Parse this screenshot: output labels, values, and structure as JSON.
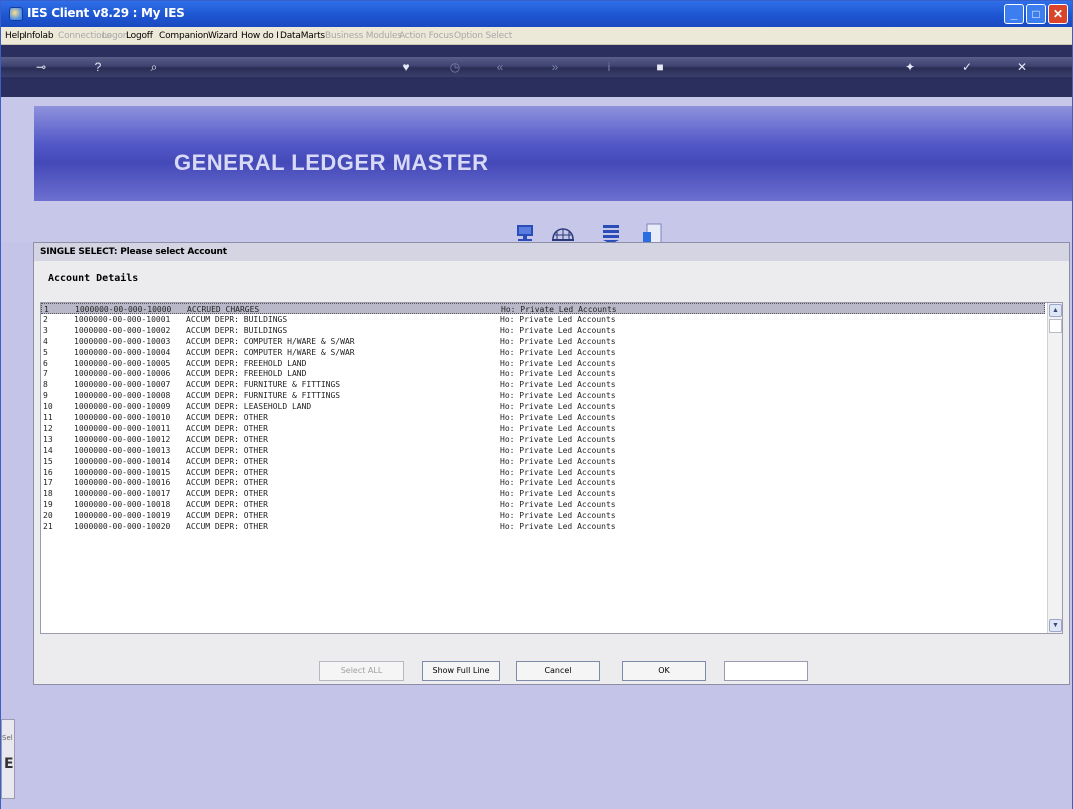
{
  "window": {
    "title": "IES Client v8.29 : My IES",
    "controls": [
      "minimize",
      "maximize",
      "close"
    ]
  },
  "menu": [
    {
      "label": "Help",
      "enabled": true
    },
    {
      "label": "Infolab",
      "enabled": true
    },
    {
      "label": "Connections",
      "enabled": false
    },
    {
      "label": "Logon",
      "enabled": false
    },
    {
      "label": "Logoff",
      "enabled": true
    },
    {
      "label": "Companion",
      "enabled": true
    },
    {
      "label": "Wizard",
      "enabled": true
    },
    {
      "label": "How do I",
      "enabled": true
    },
    {
      "label": "DataMarts",
      "enabled": true
    },
    {
      "label": "Business Modules",
      "enabled": false
    },
    {
      "label": "Action Focus",
      "enabled": false
    },
    {
      "label": "Option Select",
      "enabled": false
    }
  ],
  "toolbar": {
    "icons": [
      "key-icon",
      "help-icon",
      "search-icon",
      "heart-icon",
      "clock-icon",
      "back-icon",
      "forward-icon",
      "info-icon",
      "stop-icon",
      "tools-icon",
      "check-icon",
      "close-icon"
    ]
  },
  "banner": {
    "title": "GENERAL LEDGER MASTER"
  },
  "dialog": {
    "title": "SINGLE SELECT: Please select Account",
    "section": "Account Details",
    "rows": [
      {
        "n": "1",
        "code": "1000000-00-000-10000",
        "desc": "ACCRUED CHARGES",
        "group": "Ho: Private Led Accounts"
      },
      {
        "n": "2",
        "code": "1000000-00-000-10001",
        "desc": "ACCUM DEPR: BUILDINGS",
        "group": "Ho: Private Led Accounts"
      },
      {
        "n": "3",
        "code": "1000000-00-000-10002",
        "desc": "ACCUM DEPR: BUILDINGS",
        "group": "Ho: Private Led Accounts"
      },
      {
        "n": "4",
        "code": "1000000-00-000-10003",
        "desc": "ACCUM DEPR: COMPUTER H/WARE & S/WAR",
        "group": "Ho: Private Led Accounts"
      },
      {
        "n": "5",
        "code": "1000000-00-000-10004",
        "desc": "ACCUM DEPR: COMPUTER H/WARE & S/WAR",
        "group": "Ho: Private Led Accounts"
      },
      {
        "n": "6",
        "code": "1000000-00-000-10005",
        "desc": "ACCUM DEPR: FREEHOLD LAND",
        "group": "Ho: Private Led Accounts"
      },
      {
        "n": "7",
        "code": "1000000-00-000-10006",
        "desc": "ACCUM DEPR: FREEHOLD LAND",
        "group": "Ho: Private Led Accounts"
      },
      {
        "n": "8",
        "code": "1000000-00-000-10007",
        "desc": "ACCUM DEPR: FURNITURE & FITTINGS",
        "group": "Ho: Private Led Accounts"
      },
      {
        "n": "9",
        "code": "1000000-00-000-10008",
        "desc": "ACCUM DEPR: FURNITURE & FITTINGS",
        "group": "Ho: Private Led Accounts"
      },
      {
        "n": "10",
        "code": "1000000-00-000-10009",
        "desc": "ACCUM DEPR: LEASEHOLD LAND",
        "group": "Ho: Private Led Accounts"
      },
      {
        "n": "11",
        "code": "1000000-00-000-10010",
        "desc": "ACCUM DEPR: OTHER",
        "group": "Ho: Private Led Accounts"
      },
      {
        "n": "12",
        "code": "1000000-00-000-10011",
        "desc": "ACCUM DEPR: OTHER",
        "group": "Ho: Private Led Accounts"
      },
      {
        "n": "13",
        "code": "1000000-00-000-10012",
        "desc": "ACCUM DEPR: OTHER",
        "group": "Ho: Private Led Accounts"
      },
      {
        "n": "14",
        "code": "1000000-00-000-10013",
        "desc": "ACCUM DEPR: OTHER",
        "group": "Ho: Private Led Accounts"
      },
      {
        "n": "15",
        "code": "1000000-00-000-10014",
        "desc": "ACCUM DEPR: OTHER",
        "group": "Ho: Private Led Accounts"
      },
      {
        "n": "16",
        "code": "1000000-00-000-10015",
        "desc": "ACCUM DEPR: OTHER",
        "group": "Ho: Private Led Accounts"
      },
      {
        "n": "17",
        "code": "1000000-00-000-10016",
        "desc": "ACCUM DEPR: OTHER",
        "group": "Ho: Private Led Accounts"
      },
      {
        "n": "18",
        "code": "1000000-00-000-10017",
        "desc": "ACCUM DEPR: OTHER",
        "group": "Ho: Private Led Accounts"
      },
      {
        "n": "19",
        "code": "1000000-00-000-10018",
        "desc": "ACCUM DEPR: OTHER",
        "group": "Ho: Private Led Accounts"
      },
      {
        "n": "20",
        "code": "1000000-00-000-10019",
        "desc": "ACCUM DEPR: OTHER",
        "group": "Ho: Private Led Accounts"
      },
      {
        "n": "21",
        "code": "1000000-00-000-10020",
        "desc": "ACCUM DEPR: OTHER",
        "group": "Ho: Private Led Accounts"
      }
    ],
    "selected_row": "1",
    "buttons": {
      "select_all": "Select ALL",
      "show_full_line": "Show Full Line",
      "cancel": "Cancel",
      "ok": "OK"
    },
    "search_value": ""
  },
  "side_panel": {
    "label": "Sel",
    "glyph": "E"
  }
}
